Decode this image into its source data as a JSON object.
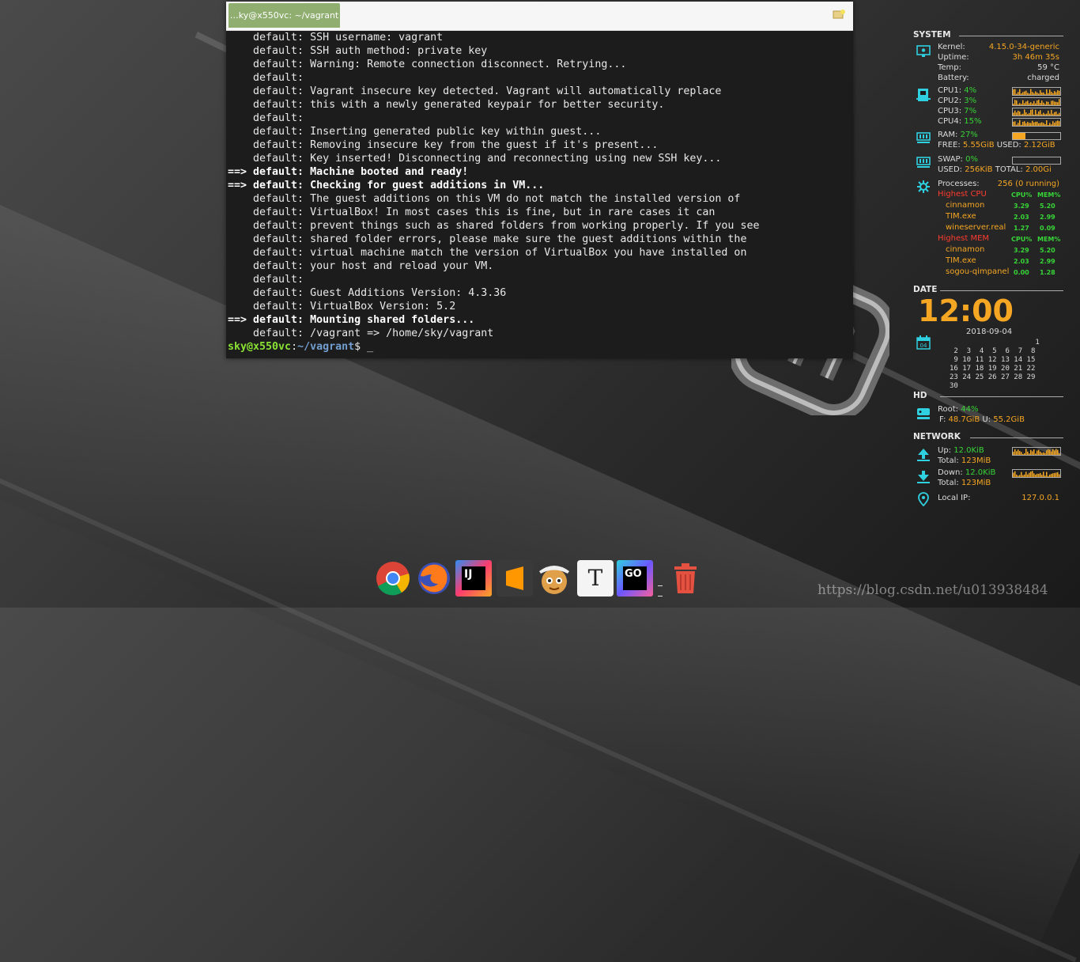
{
  "terminal": {
    "tab_title": "…ky@x550vc: ~/vagrant",
    "lines": [
      {
        "text": "    default: SSH username: vagrant",
        "bold": false
      },
      {
        "text": "    default: SSH auth method: private key",
        "bold": false
      },
      {
        "text": "    default: Warning: Remote connection disconnect. Retrying...",
        "bold": false
      },
      {
        "text": "    default: ",
        "bold": false
      },
      {
        "text": "    default: Vagrant insecure key detected. Vagrant will automatically replace",
        "bold": false
      },
      {
        "text": "    default: this with a newly generated keypair for better security.",
        "bold": false
      },
      {
        "text": "    default: ",
        "bold": false
      },
      {
        "text": "    default: Inserting generated public key within guest...",
        "bold": false
      },
      {
        "text": "    default: Removing insecure key from the guest if it's present...",
        "bold": false
      },
      {
        "text": "    default: Key inserted! Disconnecting and reconnecting using new SSH key...",
        "bold": false
      },
      {
        "text": "==> default: Machine booted and ready!",
        "bold": true
      },
      {
        "text": "==> default: Checking for guest additions in VM...",
        "bold": true
      },
      {
        "text": "    default: The guest additions on this VM do not match the installed version of",
        "bold": false
      },
      {
        "text": "    default: VirtualBox! In most cases this is fine, but in rare cases it can",
        "bold": false
      },
      {
        "text": "    default: prevent things such as shared folders from working properly. If you see",
        "bold": false
      },
      {
        "text": "    default: shared folder errors, please make sure the guest additions within the",
        "bold": false
      },
      {
        "text": "    default: virtual machine match the version of VirtualBox you have installed on",
        "bold": false
      },
      {
        "text": "    default: your host and reload your VM.",
        "bold": false
      },
      {
        "text": "    default: ",
        "bold": false
      },
      {
        "text": "    default: Guest Additions Version: 4.3.36",
        "bold": false
      },
      {
        "text": "    default: VirtualBox Version: 5.2",
        "bold": false
      },
      {
        "text": "==> default: Mounting shared folders...",
        "bold": true
      },
      {
        "text": "    default: /vagrant => /home/sky/vagrant",
        "bold": false
      }
    ],
    "prompt_user": "sky@x550vc",
    "prompt_sep": ":",
    "prompt_path": "~/vagrant",
    "prompt_symbol": "$ ",
    "cursor": "_"
  },
  "conky": {
    "system": {
      "heading": "SYSTEM",
      "kernel_label": "Kernel:",
      "kernel": "4.15.0-34-generic",
      "uptime_label": "Uptime:",
      "uptime": "3h 46m 35s",
      "temp_label": "Temp:",
      "temp": "59 °C",
      "battery_label": "Battery:",
      "battery": "charged",
      "cpus": [
        {
          "label": "CPU1:",
          "value": "4%"
        },
        {
          "label": "CPU2:",
          "value": "3%"
        },
        {
          "label": "CPU3:",
          "value": "7%"
        },
        {
          "label": "CPU4:",
          "value": "15%"
        }
      ],
      "ram_label": "RAM:",
      "ram": "27%",
      "ram_fraction": 0.27,
      "ram_free_label": "FREE:",
      "ram_free": "5.55GiB",
      "ram_used_label": "USED:",
      "ram_used": "2.12GiB",
      "swap_label": "SWAP:",
      "swap": "0%",
      "swap_fraction": 0.0,
      "swap_used_label": "USED:",
      "swap_used": "256KiB",
      "swap_total_label": "TOTAL:",
      "swap_total": "2.00Gi",
      "processes_label": "Processes:",
      "processes": "256 (0 running)",
      "highest_cpu_label": "Highest CPU",
      "highest_mem_label": "Highest MEM",
      "cpu_col": "CPU%",
      "mem_col": "MEM%",
      "top_cpu": [
        {
          "name": "cinnamon",
          "cpu": "3.29",
          "mem": "5.20"
        },
        {
          "name": "TIM.exe",
          "cpu": "2.03",
          "mem": "2.99"
        },
        {
          "name": "wineserver.real",
          "cpu": "1.27",
          "mem": "0.09"
        }
      ],
      "top_mem": [
        {
          "name": "cinnamon",
          "cpu": "3.29",
          "mem": "5.20"
        },
        {
          "name": "TIM.exe",
          "cpu": "2.03",
          "mem": "2.99"
        },
        {
          "name": "sogou-qimpanel",
          "cpu": "0.00",
          "mem": "1.28"
        }
      ]
    },
    "date": {
      "heading": "DATE",
      "time": "12:00",
      "date": "2018-09-04",
      "calendar_icon_day": "04",
      "cal_rows": [
        "                    1",
        " 2  3  4  5  6  7  8",
        " 9 10 11 12 13 14 15",
        "16 17 18 19 20 21 22",
        "23 24 25 26 27 28 29",
        "30"
      ]
    },
    "hd": {
      "heading": "HD",
      "root_label": "Root:",
      "root": "44%",
      "free_label": "F:",
      "free": "48.7GiB",
      "used_label": "U:",
      "used": "55.2GiB"
    },
    "network": {
      "heading": "NETWORK",
      "up_label": "Up:",
      "up": "12.0KiB",
      "up_total_label": "Total:",
      "up_total": "123MiB",
      "down_label": "Down:",
      "down": "12.0KiB",
      "down_total_label": "Total:",
      "down_total": "123MiB",
      "ip_label": "Local IP:",
      "ip": "127.0.0.1"
    }
  },
  "dock": {
    "items": [
      {
        "name": "chrome-icon"
      },
      {
        "name": "firefox-icon"
      },
      {
        "name": "intellij-icon",
        "text": "IJ"
      },
      {
        "name": "sublime-text-icon"
      },
      {
        "name": "wine-tim-icon"
      },
      {
        "name": "typora-icon",
        "text": "T"
      },
      {
        "name": "goland-icon",
        "text": "GO"
      },
      {
        "name": "trash-icon"
      }
    ]
  },
  "watermark": "https://blog.csdn.net/u013938484",
  "colors": {
    "accent": "#f5a623",
    "green": "#37d437",
    "red": "#ff3b30",
    "tab": "#8fae70"
  }
}
